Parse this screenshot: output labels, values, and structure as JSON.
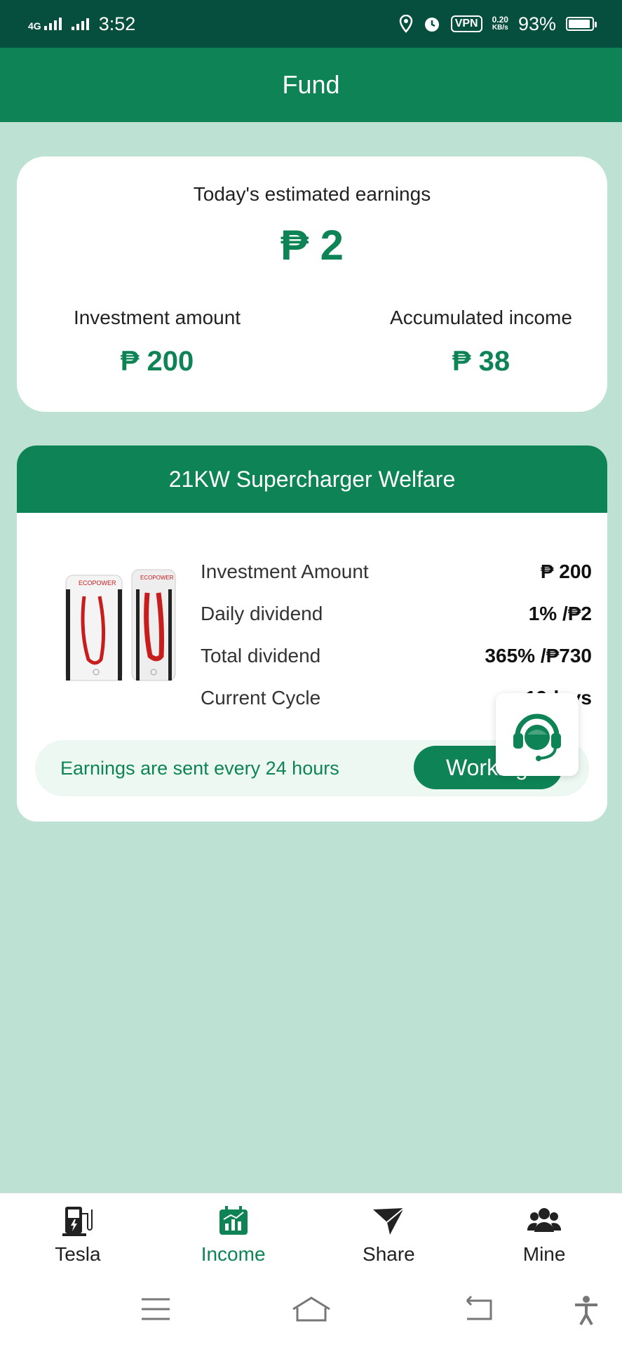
{
  "status_bar": {
    "network": "4G",
    "time": "3:52",
    "vpn": "VPN",
    "speed_value": "0.20",
    "speed_unit": "KB/s",
    "battery": "93%",
    "battery_level": 0.93
  },
  "header": {
    "title": "Fund"
  },
  "earnings": {
    "title": "Today's estimated earnings",
    "value": "₱ 2",
    "investment_label": "Investment amount",
    "investment_value": "₱ 200",
    "accumulated_label": "Accumulated income",
    "accumulated_value": "₱ 38"
  },
  "product": {
    "title": "21KW Supercharger Welfare",
    "rows": [
      {
        "label": "Investment Amount",
        "value": "₱ 200"
      },
      {
        "label": "Daily dividend",
        "value": "1% /₱2"
      },
      {
        "label": "Total dividend",
        "value": "365% /₱730"
      },
      {
        "label": "Current Cycle",
        "value": "19days"
      }
    ],
    "note": "Earnings are sent every 24 hours",
    "status_button": "Working",
    "image_brand": "ECOPOWER"
  },
  "support": {
    "icon": "customer-service-icon"
  },
  "bottom_nav": [
    {
      "label": "Tesla",
      "icon": "charger-icon"
    },
    {
      "label": "Income",
      "icon": "income-chart-icon",
      "active": true
    },
    {
      "label": "Share",
      "icon": "send-icon"
    },
    {
      "label": "Mine",
      "icon": "users-icon"
    }
  ],
  "colors": {
    "primary": "#0e8456",
    "status_bar": "#064f3e",
    "background": "#bde1d2"
  }
}
